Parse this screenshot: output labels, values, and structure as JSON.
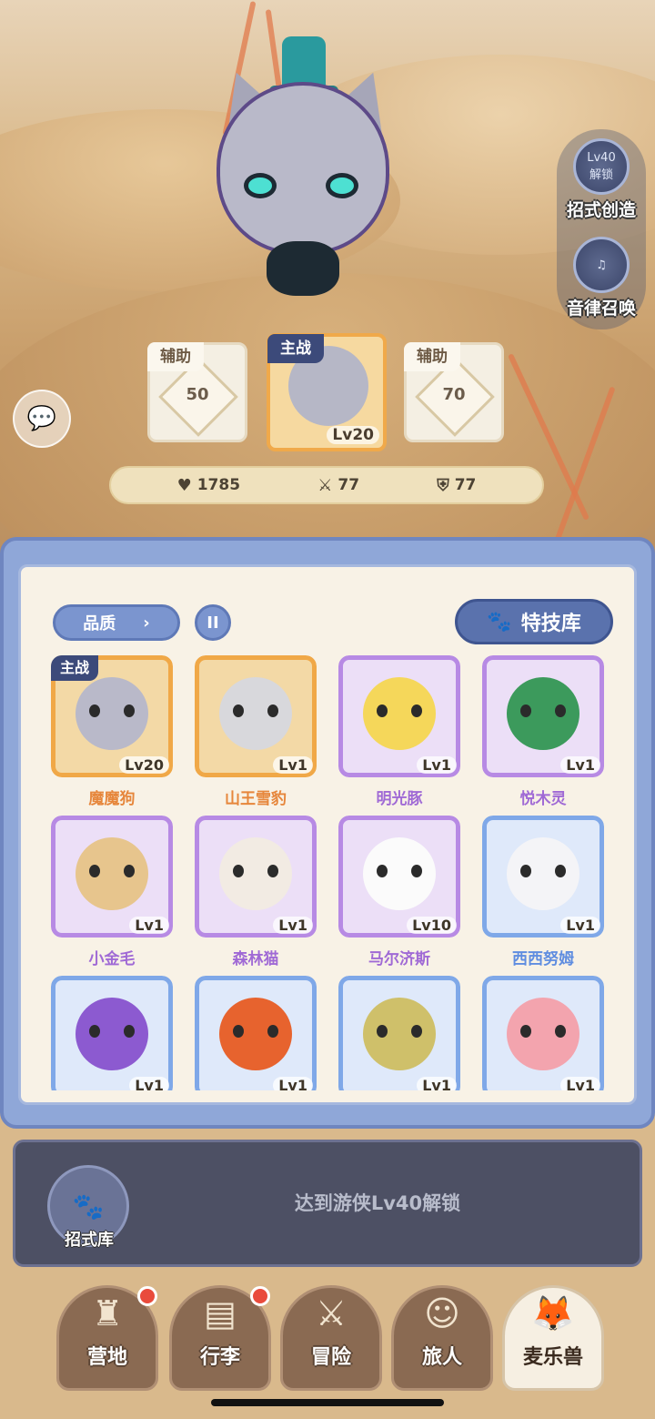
{
  "side": {
    "skill_create": {
      "badge_top": "Lv40",
      "badge_bottom": "解锁",
      "label": "招式创造"
    },
    "melody_summon": {
      "label": "音律召唤"
    }
  },
  "team": {
    "left": {
      "tag": "辅助",
      "value": "50"
    },
    "main": {
      "tag": "主战",
      "level": "Lv20"
    },
    "right": {
      "tag": "辅助",
      "value": "70"
    }
  },
  "stats": {
    "hp": "1785",
    "attack": "77",
    "defense": "77"
  },
  "toolbar": {
    "quality_label": "品质",
    "sort_label": "II",
    "skills_label": "特技库"
  },
  "main_tag": "主战",
  "pets": [
    {
      "name": "魔魔狗",
      "level": "Lv20",
      "rarity": "orange"
    },
    {
      "name": "山王雪豹",
      "level": "Lv1",
      "rarity": "orange"
    },
    {
      "name": "明光豚",
      "level": "Lv1",
      "rarity": "purple"
    },
    {
      "name": "悦木灵",
      "level": "Lv1",
      "rarity": "purple"
    },
    {
      "name": "小金毛",
      "level": "Lv1",
      "rarity": "purple"
    },
    {
      "name": "森林猫",
      "level": "Lv1",
      "rarity": "purple"
    },
    {
      "name": "马尔济斯",
      "level": "Lv10",
      "rarity": "purple"
    },
    {
      "name": "西西努姆",
      "level": "Lv1",
      "rarity": "blue"
    },
    {
      "name": "",
      "level": "Lv1",
      "rarity": "blue"
    },
    {
      "name": "",
      "level": "Lv1",
      "rarity": "blue"
    },
    {
      "name": "",
      "level": "Lv1",
      "rarity": "blue"
    },
    {
      "name": "",
      "level": "Lv1",
      "rarity": "blue"
    }
  ],
  "locked": {
    "label": "招式库",
    "message": "达到游侠Lv40解锁"
  },
  "nav": {
    "camp": "营地",
    "bag": "行李",
    "adventure": "冒险",
    "traveler": "旅人",
    "pets": "麦乐兽"
  },
  "colors": {
    "orange": "#f0a847",
    "purple": "#b78ae4",
    "blue": "#7fa8e8",
    "panel": "#8fa7d8",
    "alert": "#e94b3c"
  }
}
